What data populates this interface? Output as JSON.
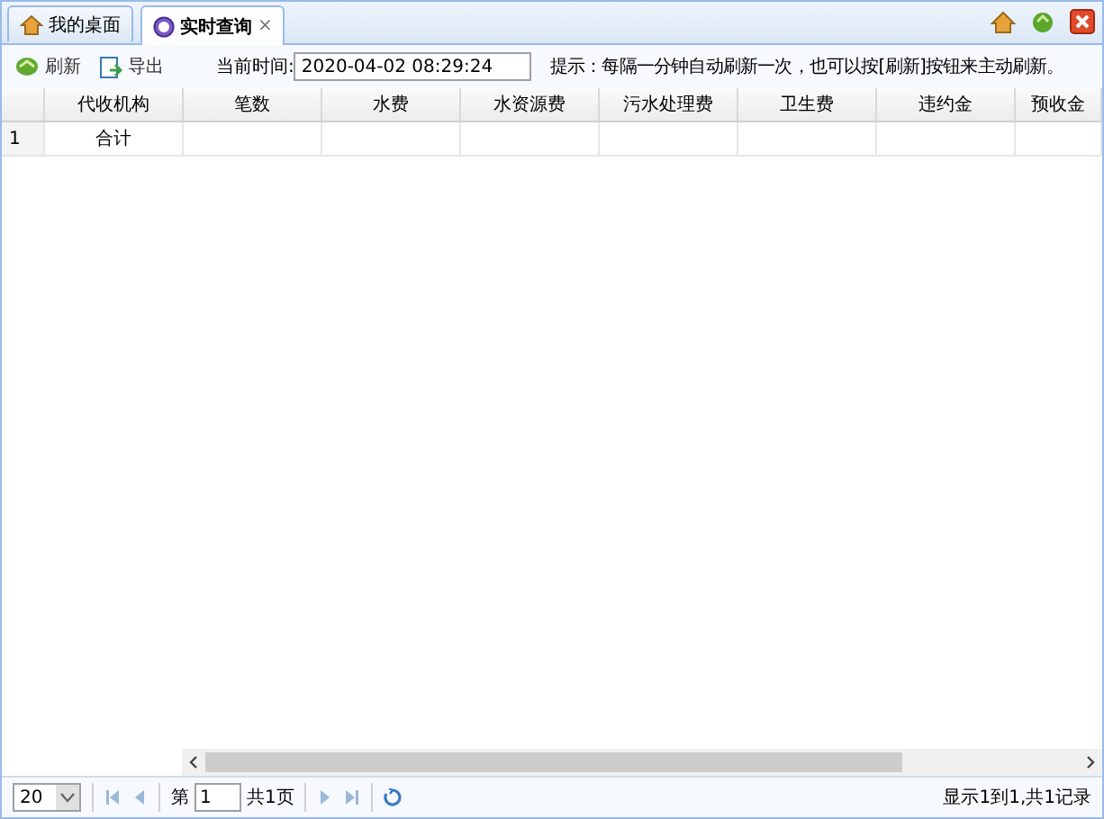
{
  "tabs": [
    {
      "label": "我的桌面",
      "selected": false
    },
    {
      "label": "实时查询",
      "selected": true,
      "close": "×"
    }
  ],
  "toolbar": {
    "buttons": [
      {
        "label": "刷新"
      },
      {
        "label": "导出"
      }
    ],
    "time_label": "当前时间:",
    "time_value": "2020-04-02 08:29:24",
    "hint": "提示：每隔一分钟自动刷新一次，也可以按[刷新]按钮来主动刷新。"
  },
  "table": {
    "columns": [
      "代收机构",
      "笔数",
      "水费",
      "水资源费",
      "污水处理费",
      "卫生费",
      "违约金",
      "预收金"
    ],
    "rows": [
      {
        "row_number": "1",
        "cells": [
          "合计",
          "",
          "",
          "",
          "",
          "",
          "",
          ""
        ]
      }
    ]
  },
  "pager": {
    "page_size": "20",
    "page_label": "第",
    "page_value": "1",
    "page_total": "共1页",
    "summary": "显示1到1,共1记录"
  }
}
